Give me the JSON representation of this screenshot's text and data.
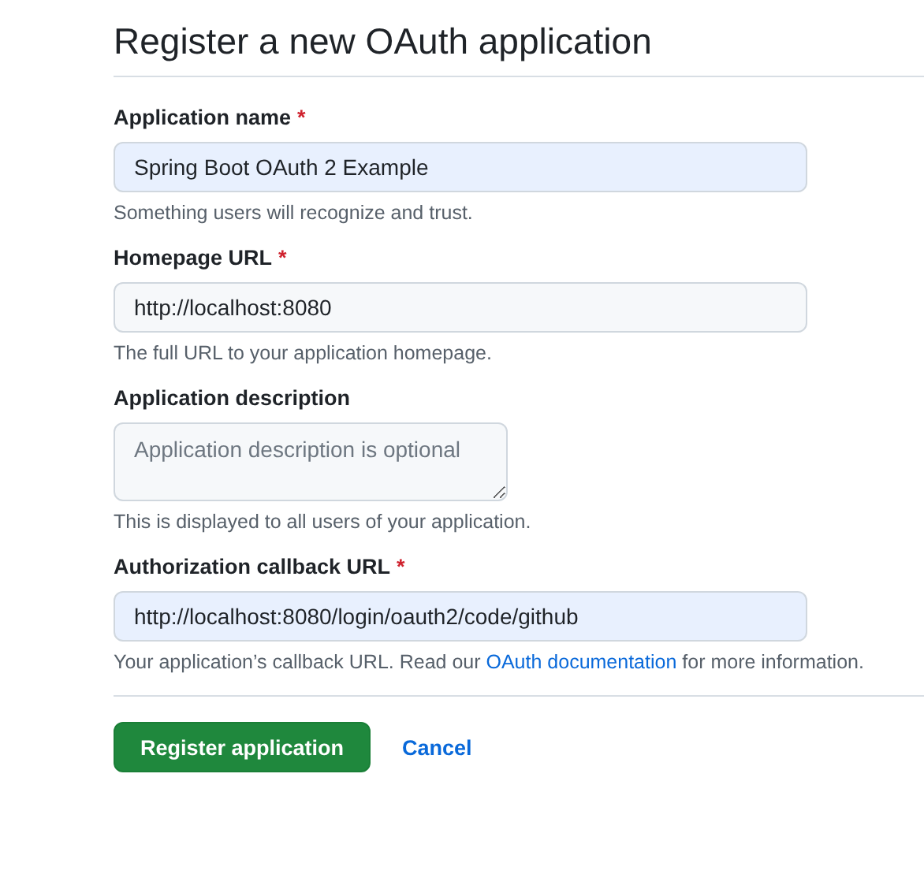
{
  "title": "Register a new OAuth application",
  "fields": [
    {
      "kind": "input",
      "label": "Application name",
      "required_mark": "*",
      "value": "Spring Boot OAuth 2 Example",
      "autofilled": true,
      "hint": "Something users will recognize and trust."
    },
    {
      "kind": "input",
      "label": "Homepage URL",
      "required_mark": "*",
      "value": "http://localhost:8080",
      "autofilled": false,
      "hint": "The full URL to your application homepage."
    },
    {
      "kind": "textarea",
      "label": "Application description",
      "placeholder": "Application description is optional",
      "autofilled": false,
      "hint": "This is displayed to all users of your application."
    },
    {
      "kind": "input",
      "label": "Authorization callback URL",
      "required_mark": "*",
      "value": "http://localhost:8080/login/oauth2/code/github",
      "autofilled": true,
      "hint": "Your application’s callback URL. Read our ",
      "hint_link": "OAuth documentation",
      "hint_after": " for more information."
    }
  ],
  "buttons": [
    {
      "kind": "primary",
      "label": "Register application"
    },
    {
      "kind": "link",
      "label": "Cancel"
    }
  ]
}
